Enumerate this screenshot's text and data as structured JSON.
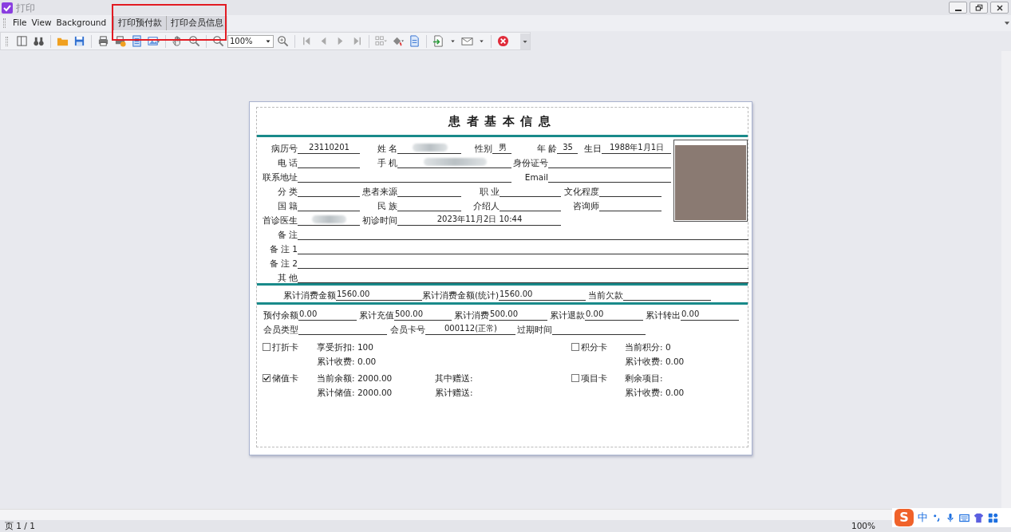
{
  "window": {
    "title": "打印"
  },
  "menu": [
    {
      "label": "File",
      "kind": "menu"
    },
    {
      "label": "View",
      "kind": "menu"
    },
    {
      "label": "Background",
      "kind": "menu"
    },
    {
      "label": "打印预付款",
      "kind": "button"
    },
    {
      "label": "打印会员信息",
      "kind": "button"
    }
  ],
  "toolbar": {
    "zoom": "100%"
  },
  "report": {
    "title": "患者基本信息",
    "rows": [
      [
        {
          "label": "病历号",
          "value": "23110201"
        },
        {
          "label": "姓 名",
          "redacted": true
        },
        {
          "label": "性别",
          "value": "男"
        },
        {
          "label": "年 龄",
          "value": "35"
        },
        {
          "label": "生日",
          "value": "1988年1月1日"
        }
      ],
      [
        {
          "label": "电 话"
        },
        {
          "label": "手 机",
          "redacted": true
        },
        {
          "label": "身份证号"
        }
      ],
      [
        {
          "label": "联系地址"
        },
        {
          "label": "Email"
        }
      ],
      [
        {
          "label": "分 类"
        },
        {
          "label": "患者来源"
        },
        {
          "label": "职 业"
        },
        {
          "label": "文化程度"
        }
      ],
      [
        {
          "label": "国 籍"
        },
        {
          "label": "民 族"
        },
        {
          "label": "介绍人"
        },
        {
          "label": "咨询师"
        }
      ],
      [
        {
          "label": "首诊医生",
          "redacted": true
        },
        {
          "label": "初诊时间",
          "value": "2023年11月2日 10:44"
        }
      ]
    ],
    "remarks": [
      {
        "label": "备 注"
      },
      {
        "label": "备 注 1"
      },
      {
        "label": "备 注 2"
      },
      {
        "label": "其 他"
      }
    ],
    "totals": [
      {
        "label": "累计消费金额",
        "value": "1560.00"
      },
      {
        "label": "累计消费金额(统计)",
        "value": "1560.00"
      },
      {
        "label": "当前欠款"
      }
    ],
    "account": [
      [
        {
          "label": "预付余额",
          "value": "0.00"
        },
        {
          "label": "累计充值",
          "value": "500.00"
        },
        {
          "label": "累计消费",
          "value": "500.00"
        },
        {
          "label": "累计退款",
          "value": "0.00"
        },
        {
          "label": "累计转出",
          "value": "0.00"
        }
      ],
      [
        {
          "label": "会员类型"
        },
        {
          "label": "会员卡号",
          "value": "000112(正常)"
        },
        {
          "label": "过期时间"
        }
      ]
    ],
    "cards": [
      {
        "label": "打折卡",
        "checked": false,
        "details": [
          [
            "享受折扣: 100"
          ],
          [
            "累计收费: 0.00"
          ]
        ]
      },
      {
        "label": "积分卡",
        "checked": false,
        "details": [
          [
            "当前积分: 0"
          ],
          [
            "累计收费: 0.00"
          ]
        ]
      },
      {
        "label": "储值卡",
        "checked": true,
        "details": [
          [
            "当前余额: 2000.00",
            "其中赠送:"
          ],
          [
            "累计储值: 2000.00",
            "累计赠送:"
          ]
        ]
      },
      {
        "label": "项目卡",
        "checked": false,
        "details": [
          [
            "剩余项目:"
          ],
          [
            "累计收费: 0.00"
          ]
        ]
      }
    ]
  },
  "status_bar": {
    "page": "页 1 / 1",
    "zoom": "100%"
  },
  "ime": {
    "logo": "S",
    "mode": "中"
  }
}
